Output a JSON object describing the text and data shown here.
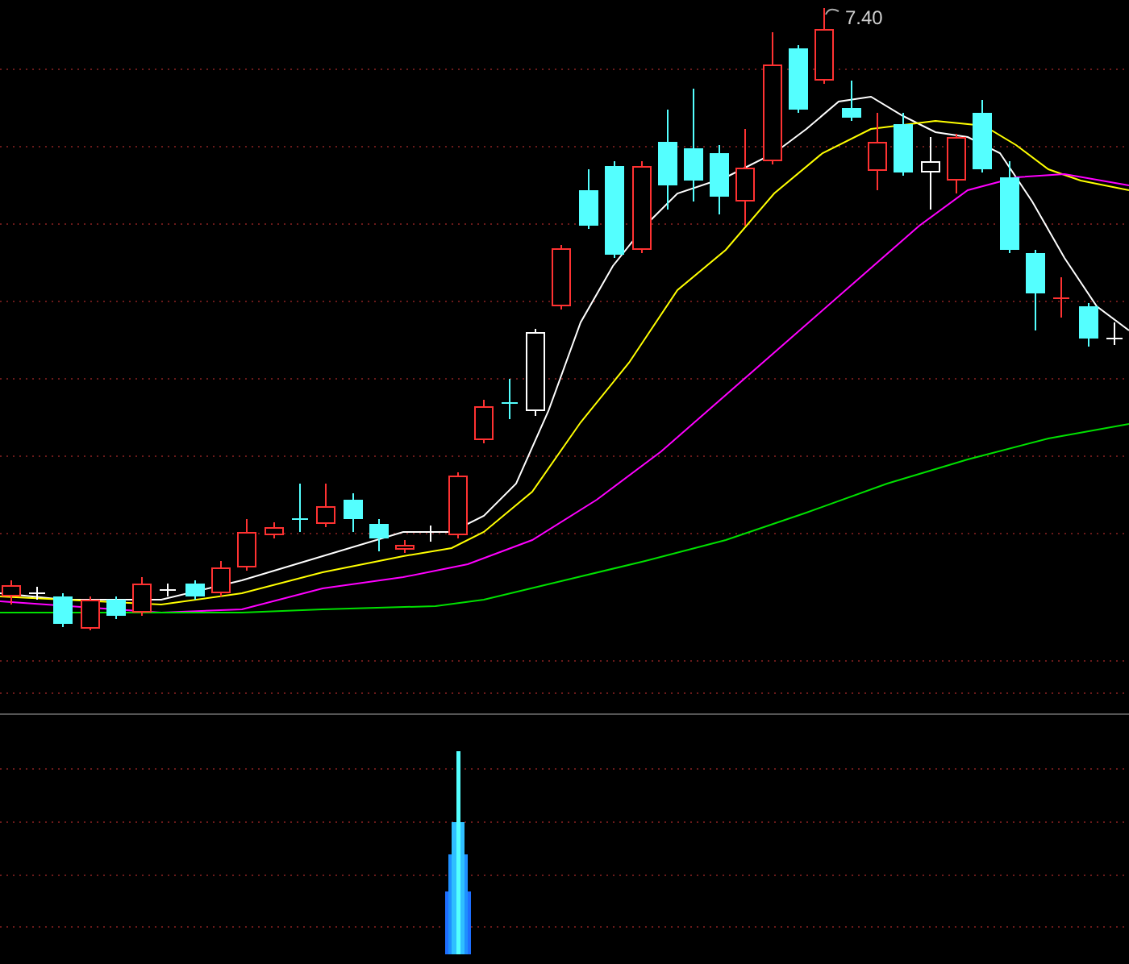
{
  "price_chart": {
    "high_label": "7.40"
  }
}
